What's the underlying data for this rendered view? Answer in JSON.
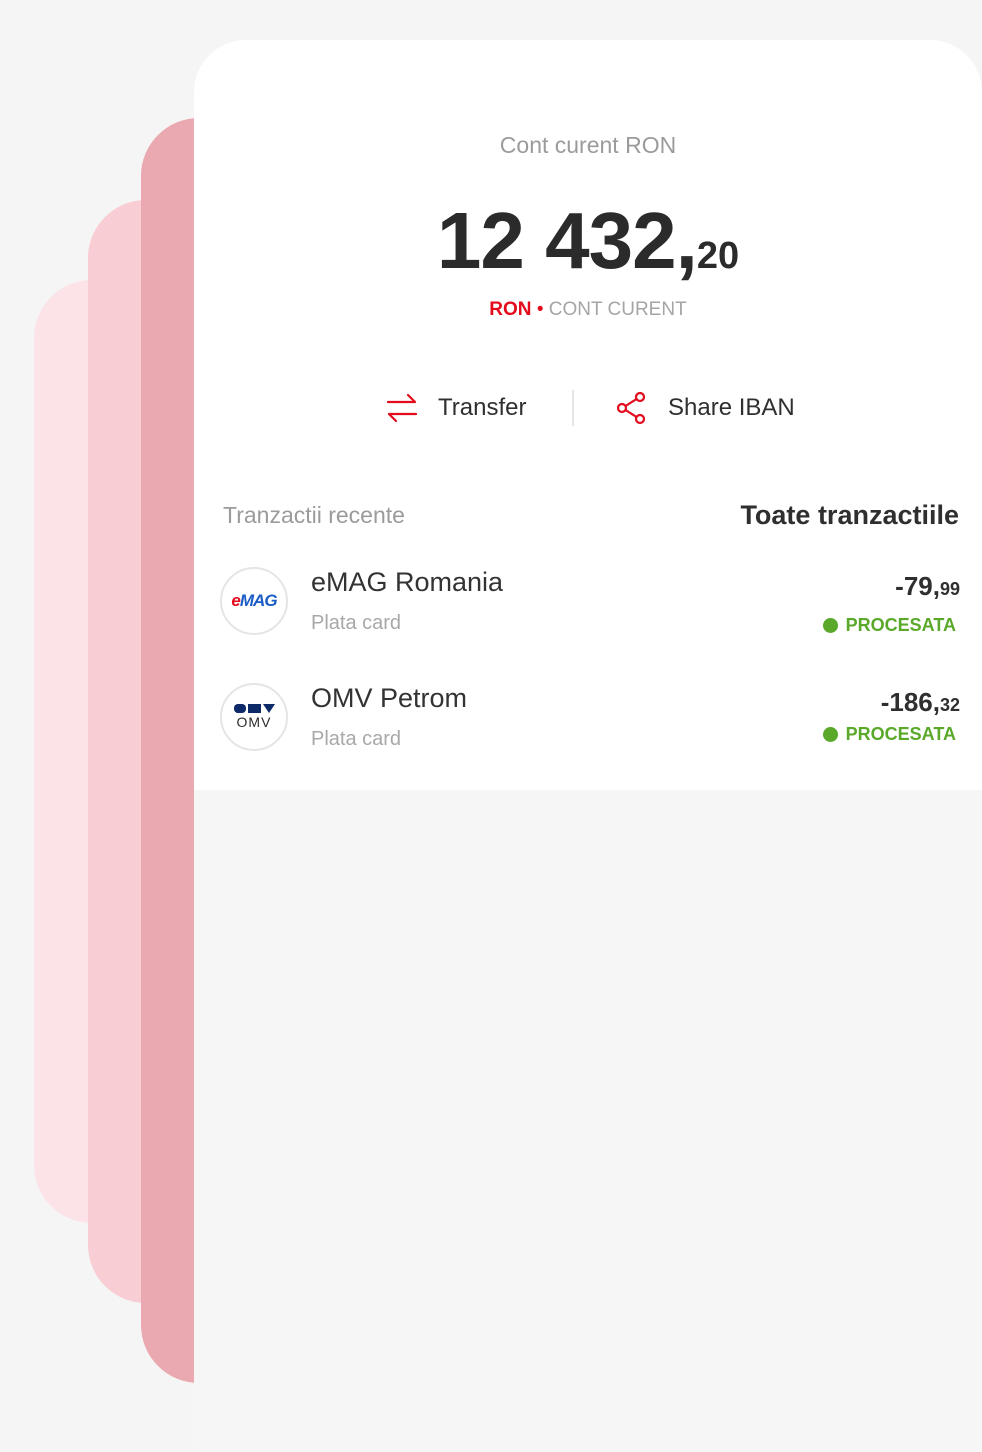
{
  "account": {
    "label": "Cont curent RON",
    "balance_int": "12 432,",
    "balance_dec": "20",
    "currency": "RON",
    "separator": "•",
    "account_type": "CONT CURENT"
  },
  "actions": {
    "transfer_label": "Transfer",
    "share_label": "Share IBAN"
  },
  "recent": {
    "title": "Tranzactii recente",
    "all_link": "Toate tranzactiile"
  },
  "transactions": [
    {
      "name": "eMAG Romania",
      "type": "Plata card",
      "amount_int": "-79,",
      "amount_dec": "99",
      "status": "PROCESATA",
      "logo": "eMAG"
    },
    {
      "name": "OMV Petrom",
      "type": "Plata card",
      "amount_int": "-186,",
      "amount_dec": "32",
      "status": "PROCESATA",
      "logo": "OMV"
    }
  ],
  "icons": {
    "transfer": "transfer-arrows-icon",
    "share": "share-icon"
  },
  "colors": {
    "brand_red": "#e30b1c",
    "status_green": "#5aa92a"
  }
}
